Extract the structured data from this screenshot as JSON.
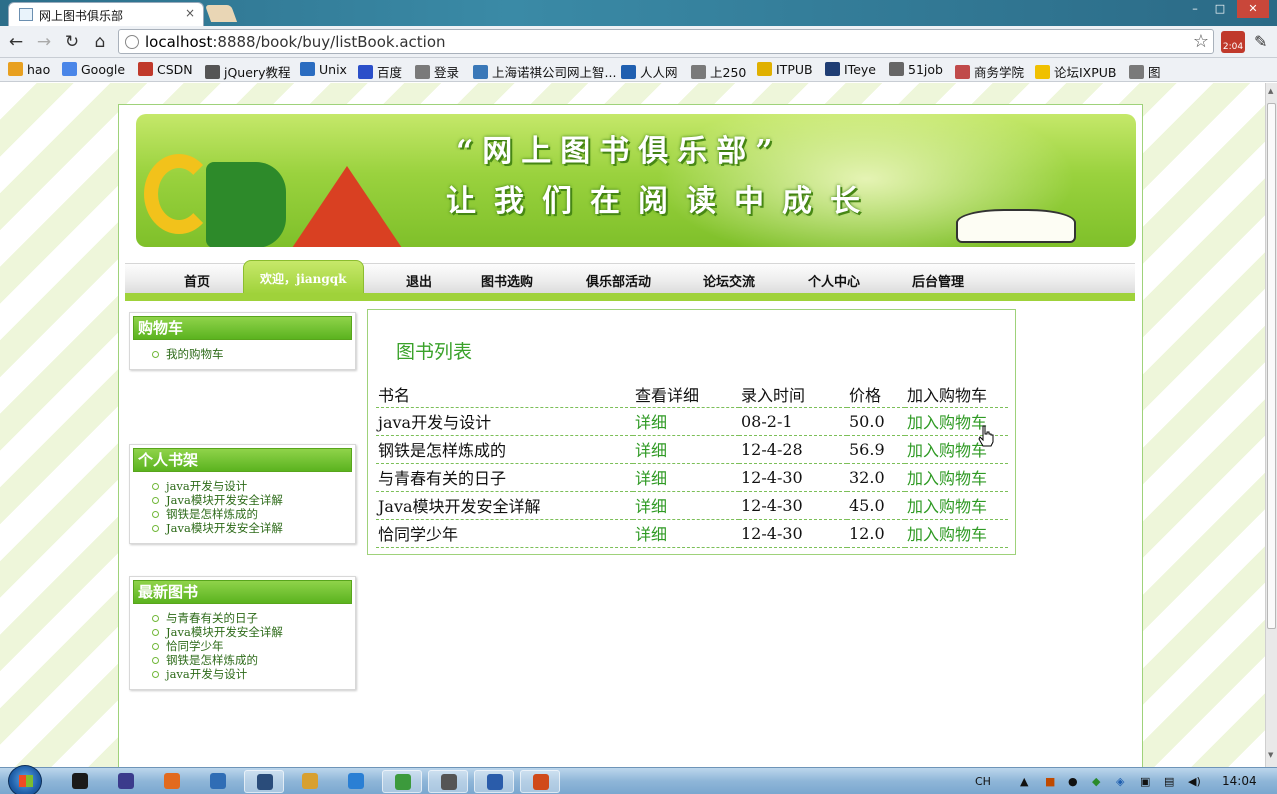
{
  "browser": {
    "tab_title": "网上图书俱乐部",
    "tab_close": "×",
    "url_host": "localhost",
    "url_path": ":8888/book/buy/listBook.action",
    "back_icon": "←",
    "forward_icon": "→",
    "reload_icon": "↻",
    "home_icon": "⌂",
    "star_icon": "☆",
    "extension_badge": "2:04",
    "window_min": "–",
    "window_max": "□",
    "window_close": "✕",
    "bookmarks": [
      {
        "label": "hao",
        "color": "#e8a020"
      },
      {
        "label": "Google",
        "color": "#4a86e8"
      },
      {
        "label": "CSDN",
        "color": "#c0392b"
      },
      {
        "label": "jQuery教程",
        "color": "#555555"
      },
      {
        "label": "Unix",
        "color": "#2a6cc0"
      },
      {
        "label": "百度",
        "color": "#2b4fc9"
      },
      {
        "label": "登录",
        "color": "#7a7a7a"
      },
      {
        "label": "上海诺祺公司网上智...",
        "color": "#3a78b8"
      },
      {
        "label": "人人网",
        "color": "#1f5fb0"
      },
      {
        "label": "上250",
        "color": "#7a7a7a"
      },
      {
        "label": "ITPUB",
        "color": "#e0b000"
      },
      {
        "label": "ITeye",
        "color": "#1f3d74"
      },
      {
        "label": "51job",
        "color": "#666666"
      },
      {
        "label": "商务学院",
        "color": "#c04a4a"
      },
      {
        "label": "论坛IXPUB",
        "color": "#f0c000"
      },
      {
        "label": "图",
        "color": "#7a7a7a"
      }
    ]
  },
  "banner": {
    "line1": "“网上图书俱乐部”",
    "line2": "让我们在阅读中成长"
  },
  "menu": {
    "items": [
      "首页",
      "欢迎，jiangqk",
      "退出",
      "图书选购",
      "俱乐部活动",
      "论坛交流",
      "个人中心",
      "后台管理"
    ],
    "active_index": 1
  },
  "sidebar": {
    "cart": {
      "title": "购物车",
      "items": [
        "我的购物车"
      ]
    },
    "shelf": {
      "title": "个人书架",
      "items": [
        "java开发与设计",
        "Java模块开发安全详解",
        "钢铁是怎样炼成的",
        "Java模块开发安全详解"
      ]
    },
    "latest": {
      "title": "最新图书",
      "items": [
        "与青春有关的日子",
        "Java模块开发安全详解",
        "恰同学少年",
        "钢铁是怎样炼成的",
        "java开发与设计"
      ]
    }
  },
  "book_list": {
    "title": "图书列表",
    "columns": [
      "书名",
      "查看详细",
      "录入时间",
      "价格",
      "加入购物车"
    ],
    "rows": [
      {
        "name": "java开发与设计",
        "detail": "详细",
        "date": "08-2-1",
        "price": "50.0",
        "action": "加入购物车"
      },
      {
        "name": "钢铁是怎样炼成的",
        "detail": "详细",
        "date": "12-4-28",
        "price": "56.9",
        "action": "加入购物车"
      },
      {
        "name": "与青春有关的日子",
        "detail": "详细",
        "date": "12-4-30",
        "price": "32.0",
        "action": "加入购物车"
      },
      {
        "name": "Java模块开发安全详解",
        "detail": "详细",
        "date": "12-4-30",
        "price": "45.0",
        "action": "加入购物车"
      },
      {
        "name": "恰同学少年",
        "detail": "详细",
        "date": "12-4-30",
        "price": "12.0",
        "action": "加入购物车"
      }
    ]
  },
  "taskbar": {
    "apps": [
      {
        "name": "qq",
        "color": "#1a1a1a"
      },
      {
        "name": "eclipse",
        "color": "#3b3b8c"
      },
      {
        "name": "firefox",
        "color": "#e26a1e"
      },
      {
        "name": "explorer",
        "color": "#2f6db5"
      },
      {
        "name": "app",
        "color": "#2a4c7a"
      },
      {
        "name": "app2",
        "color": "#d8a030"
      },
      {
        "name": "ie",
        "color": "#2a7fd4"
      },
      {
        "name": "chrome",
        "color": "#3c9a3c"
      },
      {
        "name": "tool",
        "color": "#555555"
      },
      {
        "name": "word",
        "color": "#2a5caa"
      },
      {
        "name": "ppt",
        "color": "#d04a1a"
      }
    ],
    "ime": "CH",
    "clock": "14:04"
  }
}
